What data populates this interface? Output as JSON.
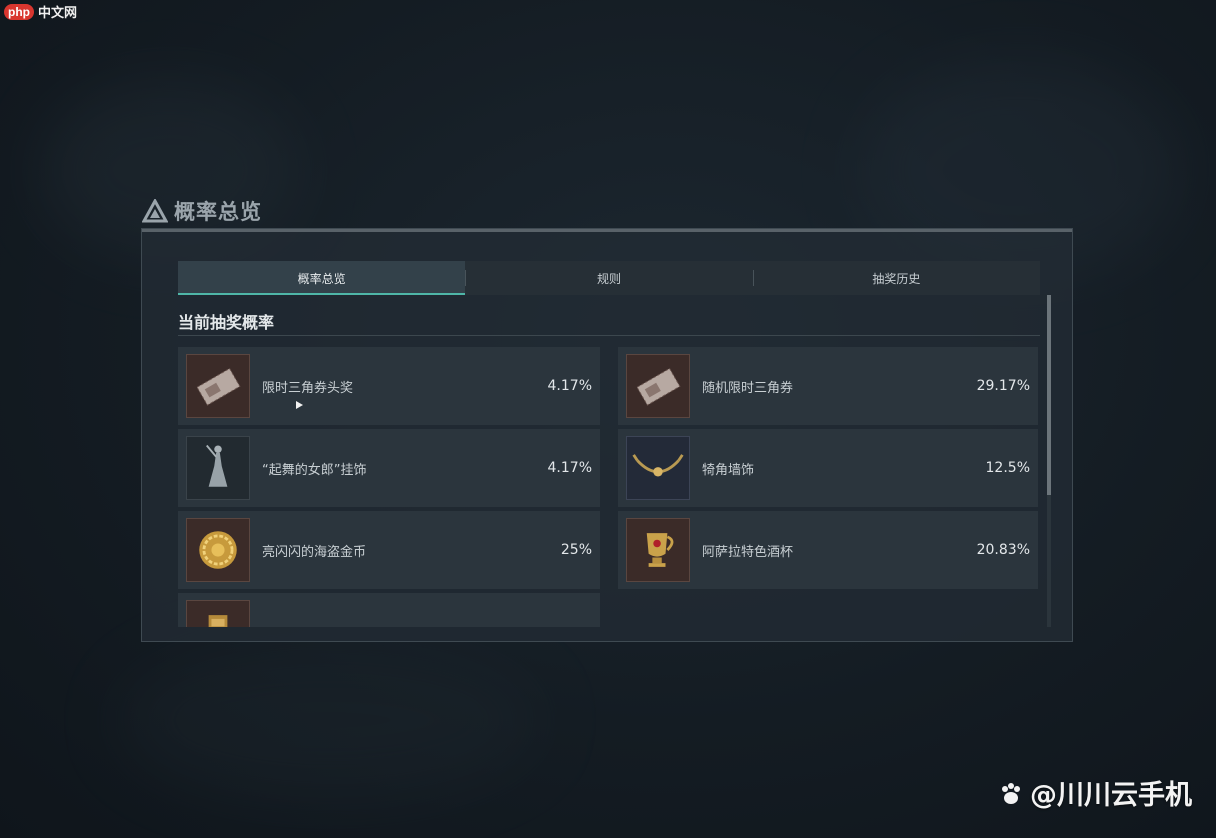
{
  "watermark_top": {
    "badge": "php",
    "text": "中文网"
  },
  "watermark_bottom": {
    "text": "@川川云手机"
  },
  "window": {
    "title": "概率总览"
  },
  "tabs": [
    {
      "label": "概率总览",
      "active": true
    },
    {
      "label": "规则",
      "active": false
    },
    {
      "label": "抽奖历史",
      "active": false
    }
  ],
  "section": {
    "title": "当前抽奖概率"
  },
  "items_left": [
    {
      "name": "限时三角券头奖",
      "pct": "4.17%",
      "icon": "ticket-icon"
    },
    {
      "name": "“起舞的女郎”挂饰",
      "pct": "4.17%",
      "icon": "dancer-figurine-icon"
    },
    {
      "name": "亮闪闪的海盗金币",
      "pct": "25%",
      "icon": "gold-coin-icon"
    },
    {
      "name": "",
      "pct": "",
      "icon": "golden-box-icon"
    }
  ],
  "items_right": [
    {
      "name": "随机限时三角券",
      "pct": "29.17%",
      "icon": "ticket-icon"
    },
    {
      "name": "犄角墙饰",
      "pct": "12.5%",
      "icon": "horn-necklace-icon"
    },
    {
      "name": "阿萨拉特色酒杯",
      "pct": "20.83%",
      "icon": "goblet-icon"
    }
  ],
  "colors": {
    "accent": "#4fb6a8",
    "panel": "#222c34",
    "rare_bg": "#3b2b28",
    "epic_bg": "#232a38"
  }
}
